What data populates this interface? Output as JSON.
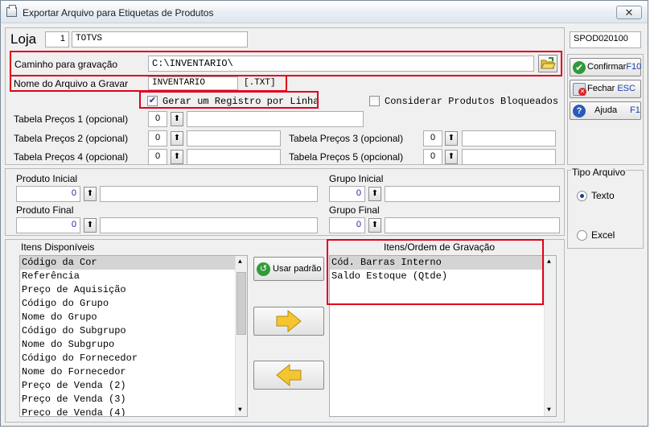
{
  "window": {
    "title": "Exportar Arquivo para Etiquetas de Produtos",
    "close_label": "✕"
  },
  "loja": {
    "label": "Loja",
    "number": "1",
    "name": "TOTVS"
  },
  "code": "SPOD020100",
  "caminho": {
    "label": "Caminho para gravação",
    "value": "C:\\INVENTARIO\\"
  },
  "nome_arquivo": {
    "label": "Nome do Arquivo a Gravar",
    "value": "INVENTARIO",
    "ext": "[.TXT]"
  },
  "options": {
    "gerar_registro": {
      "label": "Gerar um Registro por Linha",
      "checked": true
    },
    "considerar_bloqueados": {
      "label": "Considerar Produtos Bloqueados",
      "checked": false
    }
  },
  "precos": [
    {
      "label": "Tabela Preços 1 (opcional)",
      "value": "0",
      "desc": ""
    },
    {
      "label": "Tabela Preços 2 (opcional)",
      "value": "0",
      "desc": ""
    },
    {
      "label": "Tabela Preços 3 (opcional)",
      "value": "0",
      "desc": ""
    },
    {
      "label": "Tabela Preços 4 (opcional)",
      "value": "0",
      "desc": ""
    },
    {
      "label": "Tabela Preços 5 (opcional)",
      "value": "0",
      "desc": ""
    }
  ],
  "produto": {
    "inicial_label": "Produto Inicial",
    "inicial_value": "0",
    "final_label": "Produto Final",
    "final_value": "0"
  },
  "grupo": {
    "inicial_label": "Grupo Inicial",
    "inicial_value": "0",
    "final_label": "Grupo Final",
    "final_value": "0"
  },
  "buttons": {
    "confirmar": {
      "label": "Confirmar",
      "key": "F10"
    },
    "fechar": {
      "label": "Fechar",
      "key": "ESC"
    },
    "ajuda": {
      "label": "Ajuda",
      "key": "F1"
    },
    "usar_padrao": "Usar padrão"
  },
  "tipo_arquivo": {
    "label": "Tipo Arquivo",
    "options": [
      {
        "label": "Texto",
        "selected": true
      },
      {
        "label": "Excel",
        "selected": false
      }
    ]
  },
  "disponiveis": {
    "label": "Itens Disponíveis",
    "items": [
      "Código da Cor",
      "Referência",
      "Preço de Aquisição",
      "Código do Grupo",
      "Nome do Grupo",
      "Código do Subgrupo",
      "Nome do Subgrupo",
      "Código do Fornecedor",
      "Nome do Fornecedor",
      "Preço de Venda (2)",
      "Preço de Venda (3)",
      "Preço de Venda (4)"
    ]
  },
  "ordem": {
    "label": "Itens/Ordem de Gravação",
    "items": [
      "Cód. Barras Interno",
      "Saldo Estoque (Qtde)"
    ]
  }
}
